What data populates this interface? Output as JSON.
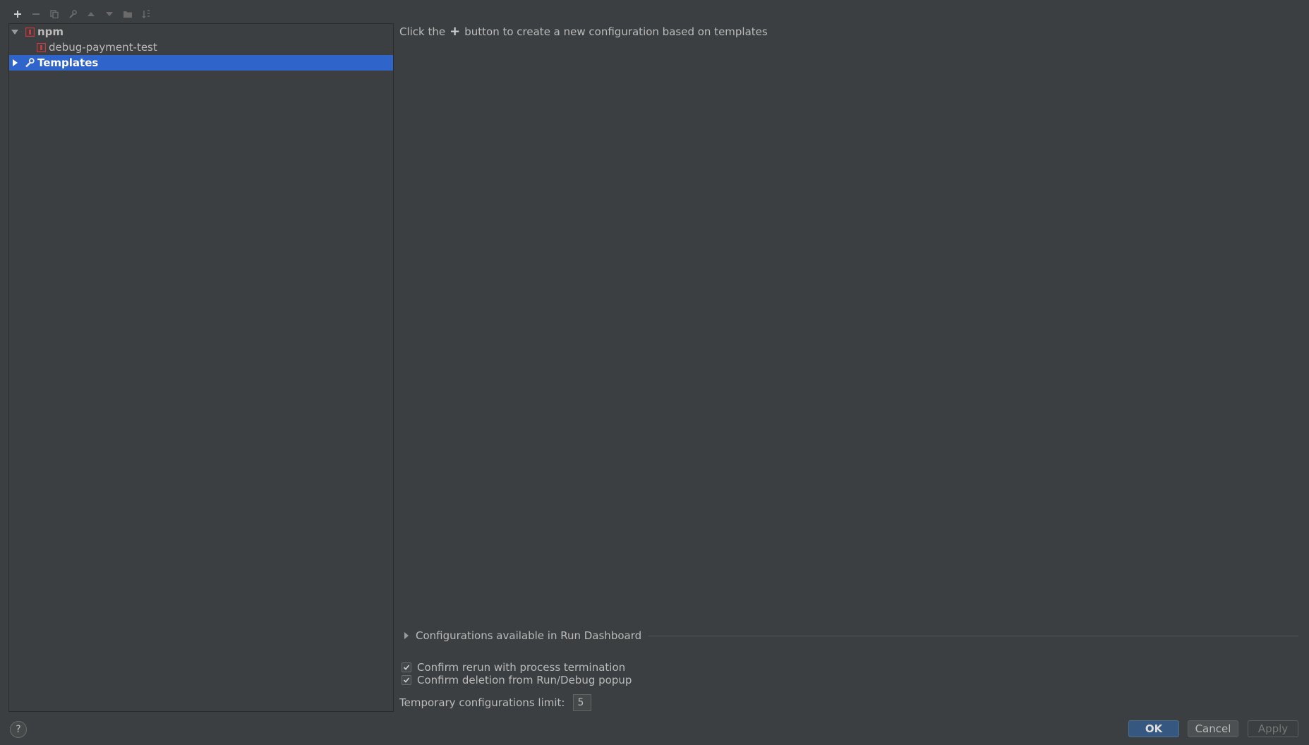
{
  "toolbar": {
    "buttons": [
      {
        "name": "add-icon",
        "enabled": true
      },
      {
        "name": "remove-icon",
        "enabled": false
      },
      {
        "name": "copy-icon",
        "enabled": false
      },
      {
        "name": "wrench-icon",
        "enabled": false
      },
      {
        "name": "move-up-icon",
        "enabled": false
      },
      {
        "name": "move-down-icon",
        "enabled": false
      },
      {
        "name": "folder-icon",
        "enabled": false
      },
      {
        "name": "sort-icon",
        "enabled": false
      }
    ]
  },
  "tree": {
    "items": [
      {
        "label": "npm",
        "icon": "npm-icon",
        "expanded": true,
        "bold": true
      },
      {
        "label": "debug-payment-test",
        "icon": "npm-icon"
      },
      {
        "label": "Templates",
        "icon": "wrench-icon",
        "expanded": false,
        "bold": true,
        "selected": true
      }
    ]
  },
  "content": {
    "hint_before": "Click the",
    "hint_plus": "+",
    "hint_after": "button to create a new configuration based on templates"
  },
  "dashboard": {
    "title": "Configurations available in Run Dashboard",
    "expanded": false
  },
  "options": {
    "confirm_rerun": {
      "label": "Confirm rerun with process termination",
      "checked": true
    },
    "confirm_deletion": {
      "label": "Confirm deletion from Run/Debug popup",
      "checked": true
    }
  },
  "temp_limit": {
    "label": "Temporary configurations limit:",
    "value": "5"
  },
  "footer": {
    "help_label": "?",
    "ok_label": "OK",
    "cancel_label": "Cancel",
    "apply_label": "Apply"
  },
  "colors": {
    "background": "#3c3f41",
    "selection": "#2f65ca",
    "npm_red": "#c93b3b",
    "ok_button": "#365880"
  }
}
